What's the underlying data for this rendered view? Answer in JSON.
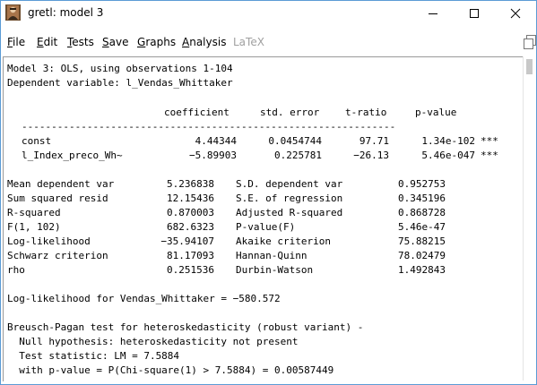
{
  "window": {
    "title": "gretl: model 3",
    "controls": {
      "minimize_icon": "minimize-icon",
      "maximize_icon": "maximize-icon",
      "close_icon": "close-icon"
    }
  },
  "menu": {
    "items": [
      {
        "label": "File",
        "accel": "F",
        "rest": "ile",
        "enabled": true
      },
      {
        "label": "Edit",
        "accel": "E",
        "rest": "dit",
        "enabled": true
      },
      {
        "label": "Tests",
        "accel": "T",
        "rest": "ests",
        "enabled": true
      },
      {
        "label": "Save",
        "accel": "S",
        "rest": "ave",
        "enabled": true
      },
      {
        "label": "Graphs",
        "accel": "G",
        "rest": "raphs",
        "enabled": true
      },
      {
        "label": "Analysis",
        "accel": "A",
        "rest": "nalysis",
        "enabled": true
      },
      {
        "label": "LaTeX",
        "accel": "",
        "rest": "LaTeX",
        "enabled": false
      }
    ]
  },
  "output": {
    "header_line1": "Model 3: OLS, using observations 1-104",
    "header_line2": "Dependent variable: l_Vendas_Whittaker",
    "coef_table": {
      "columns": [
        "coefficient",
        "std. error",
        "t-ratio",
        "p-value"
      ],
      "rule": "---------------------------------------------------------------",
      "rows": [
        {
          "name": "const",
          "coefficient": "4.44344",
          "std_error": "0.0454744",
          "t_ratio": "97.71",
          "p_value": "1.34e-102",
          "stars": "***"
        },
        {
          "name": "l_Index_preco_Wh~",
          "coefficient": "−5.89903",
          "std_error": "0.225781",
          "t_ratio": "−26.13",
          "p_value": "5.46e-047",
          "stars": "***"
        }
      ]
    },
    "stats": [
      {
        "l_label": "Mean dependent var",
        "l_value": "5.236838",
        "r_label": "S.D. dependent var",
        "r_value": "0.952753"
      },
      {
        "l_label": "Sum squared resid",
        "l_value": "12.15436",
        "r_label": "S.E. of regression",
        "r_value": "0.345196"
      },
      {
        "l_label": "R-squared",
        "l_value": "0.870003",
        "r_label": "Adjusted R-squared",
        "r_value": "0.868728"
      },
      {
        "l_label": "F(1, 102)",
        "l_value": "682.6323",
        "r_label": "P-value(F)",
        "r_value": "5.46e-47"
      },
      {
        "l_label": "Log-likelihood",
        "l_value": "−35.94107",
        "r_label": "Akaike criterion",
        "r_value": "75.88215"
      },
      {
        "l_label": "Schwarz criterion",
        "l_value": "81.17093",
        "r_label": "Hannan-Quinn",
        "r_value": "78.02479"
      },
      {
        "l_label": "rho",
        "l_value": "0.251536",
        "r_label": "Durbin-Watson",
        "r_value": "1.492843"
      }
    ],
    "loglik_line": "Log-likelihood for Vendas_Whittaker = −580.572",
    "bp_test": {
      "title": "Breusch-Pagan test for heteroskedasticity (robust variant) -",
      "null": "  Null hypothesis: heteroskedasticity not present",
      "stat": "  Test statistic: LM = 7.5884",
      "pval": "  with p-value = P(Chi-square(1) > 7.5884) = 0.00587449"
    }
  }
}
